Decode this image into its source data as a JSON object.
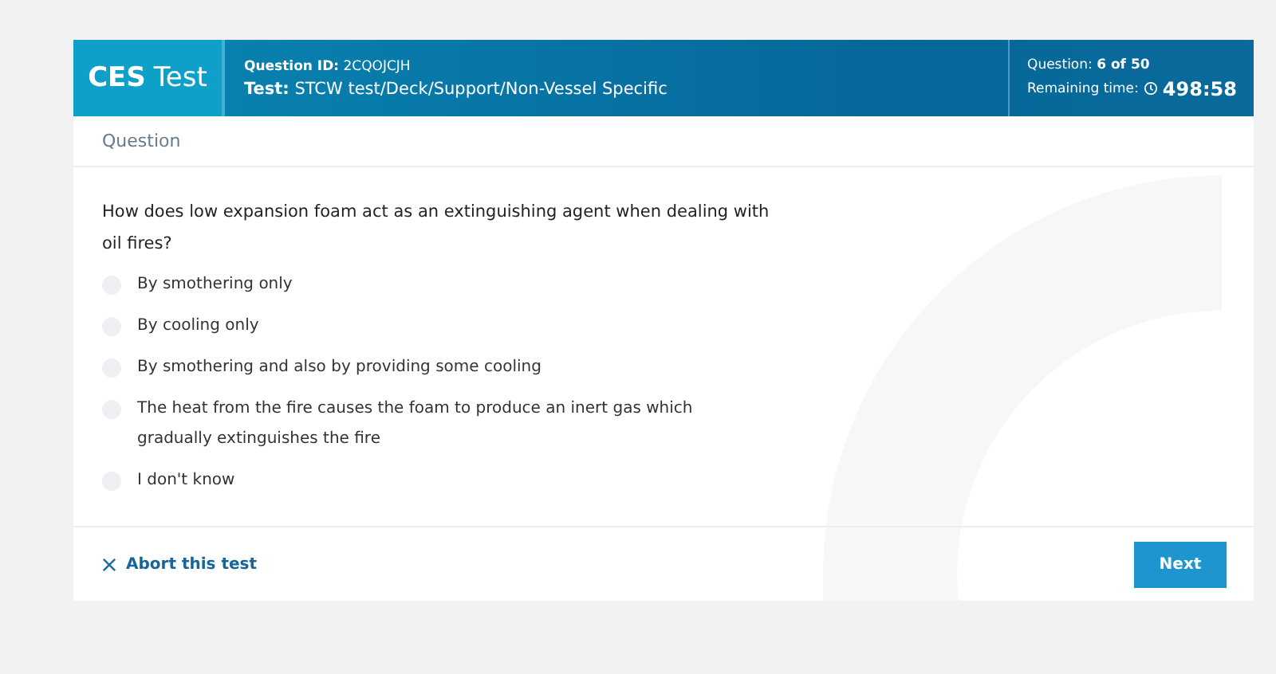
{
  "header": {
    "brand_bold": "CES",
    "brand": "Test",
    "question_id_label": "Question ID:",
    "question_id": "2CQOJCJH",
    "test_label": "Test:",
    "test": "STCW test/Deck/Support/Non-Vessel Specific",
    "progress_label": "Question:",
    "progress": "6 of 50",
    "time_label": "Remaining time:",
    "time": "498:58"
  },
  "section_title": "Question",
  "question": "How does low expansion foam act as an extinguishing agent when dealing with oil fires?",
  "options": [
    {
      "label": "By smothering only",
      "selected": false
    },
    {
      "label": "By cooling only",
      "selected": false
    },
    {
      "label": "By smothering and also by providing some cooling",
      "selected": false
    },
    {
      "label": "The heat from the fire causes the foam to produce an inert gas which gradually extinguishes the fire",
      "selected": false
    },
    {
      "label": "I don't know",
      "selected": false
    }
  ],
  "abort_link": "Abort this test",
  "next_button": "Next"
}
